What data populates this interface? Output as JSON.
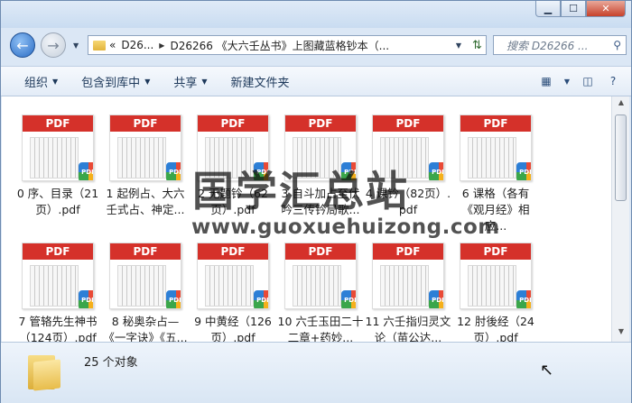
{
  "window": {
    "minimize_label": "▁",
    "maximize_label": "☐",
    "close_label": "✕"
  },
  "address": {
    "overflow": "«",
    "segments": [
      "D26...",
      "D26266 《大六壬丛书》上图藏蓝格钞本（..."
    ],
    "search_placeholder": "搜索 D26266 ..."
  },
  "toolbar": {
    "organize": "组织",
    "include_in_library": "包含到库中",
    "share": "共享",
    "new_folder": "新建文件夹"
  },
  "files": [
    {
      "name": "0 序、目录（21页）.pdf",
      "badge": "PDF"
    },
    {
      "name": "1 起例占、大六壬式占、神定...",
      "badge": "PDF"
    },
    {
      "name": "2 无题钤（62页）.pdf",
      "badge": "PDF"
    },
    {
      "name": "3 自斗加占至伏吟三传钤局歌...",
      "badge": "PDF"
    },
    {
      "name": "4 课钤（82页）.pdf",
      "badge": "PDF"
    },
    {
      "name": "6 课格（各有《观月经》相应...",
      "badge": "PDF"
    },
    {
      "name": "7 管辂先生神书（124页）.pdf",
      "badge": "PDF"
    },
    {
      "name": "8 秘奥杂占—《一字诀》《五...",
      "badge": "PDF"
    },
    {
      "name": "9 中黄经（126页）.pdf",
      "badge": "PDF"
    },
    {
      "name": "10 六壬玉田二十二章+药妙...",
      "badge": "PDF"
    },
    {
      "name": "11 六壬指归灵文论（苗公达...",
      "badge": "PDF"
    },
    {
      "name": "12 肘後经（24页）.pdf",
      "badge": "PDF"
    }
  ],
  "pdf_band_label": "PDF",
  "status": {
    "count": "25 个对象"
  },
  "watermark": {
    "cn": "国学汇总站",
    "url": "www.guoxuehuizong.com"
  }
}
